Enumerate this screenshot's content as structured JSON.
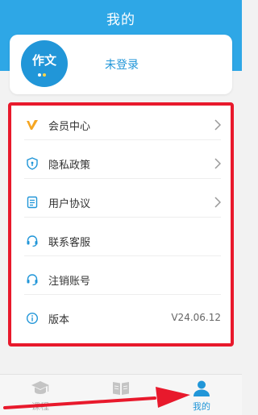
{
  "header": {
    "title": "我的"
  },
  "profile": {
    "avatar_text": "作文",
    "login_status": "未登录"
  },
  "menu": {
    "items": [
      {
        "label": "会员中心",
        "icon": "vip-icon",
        "has_chevron": true
      },
      {
        "label": "隐私政策",
        "icon": "shield-icon",
        "has_chevron": true
      },
      {
        "label": "用户协议",
        "icon": "document-icon",
        "has_chevron": true
      },
      {
        "label": "联系客服",
        "icon": "headset-icon",
        "has_chevron": false
      },
      {
        "label": "注销账号",
        "icon": "headset-icon",
        "has_chevron": false
      },
      {
        "label": "版本",
        "icon": "info-icon",
        "value": "V24.06.12",
        "has_chevron": false
      }
    ]
  },
  "tabbar": {
    "tabs": [
      {
        "label": "课程",
        "icon": "graduation-cap-icon",
        "active": false
      },
      {
        "label": "",
        "icon": "book-icon",
        "active": false
      },
      {
        "label": "我的",
        "icon": "user-icon",
        "active": true
      }
    ]
  },
  "colors": {
    "header": "#2ea7e6",
    "accent": "#2196d8",
    "highlight_border": "#e8192c",
    "vip": "#f5a623"
  }
}
